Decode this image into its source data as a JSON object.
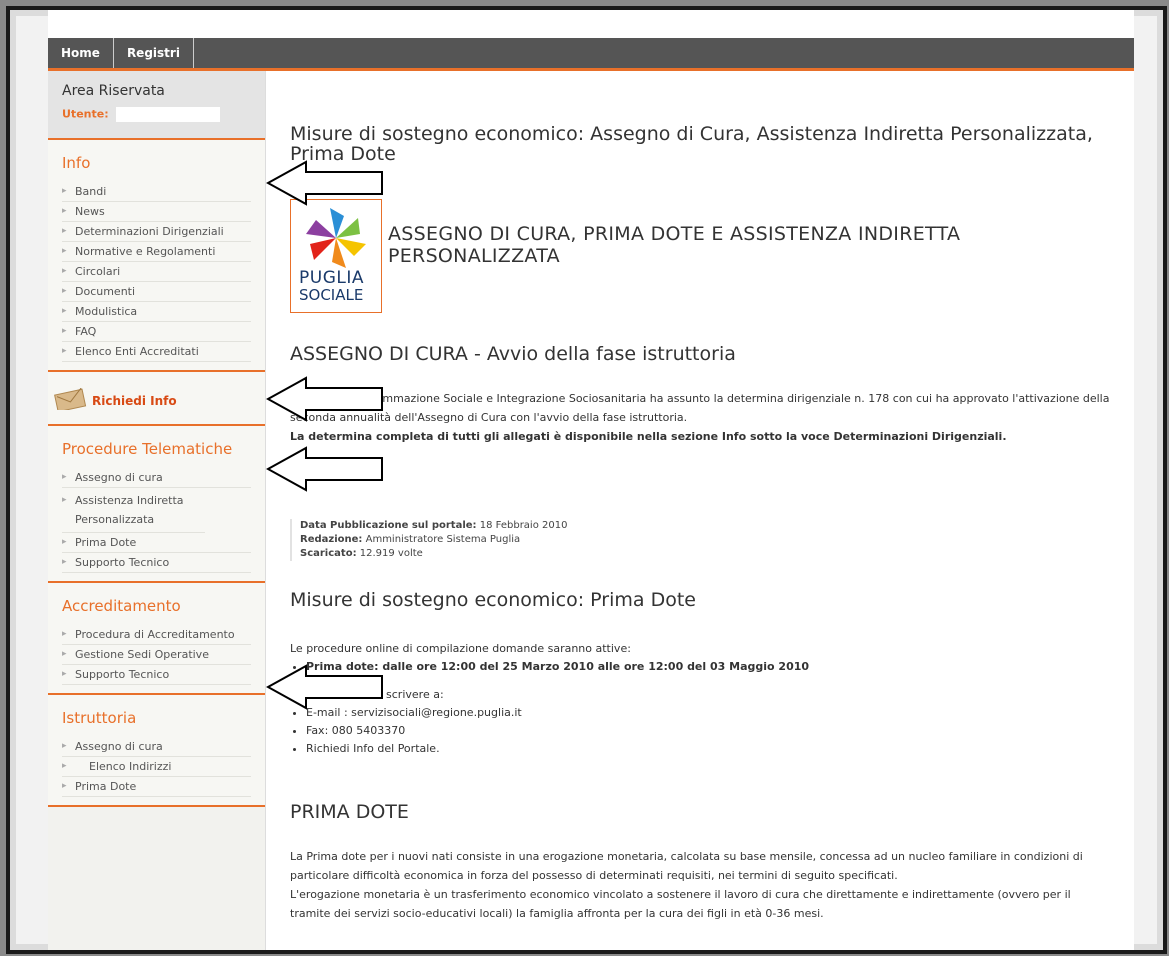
{
  "nav": {
    "home": "Home",
    "registri": "Registri"
  },
  "sidebar": {
    "area_title": "Area Riservata",
    "utente_label": "Utente:",
    "utente_value": "",
    "info": {
      "title": "Info",
      "items": [
        "Bandi",
        "News",
        "Determinazioni Dirigenziali",
        "Normative e Regolamenti",
        "Circolari",
        "Documenti",
        "Modulistica",
        "FAQ",
        "Elenco Enti Accreditati"
      ]
    },
    "richiedi_info": "Richiedi Info",
    "procedure": {
      "title": "Procedure Telematiche",
      "items": [
        "Assegno di cura",
        "Assistenza Indiretta Personalizzata",
        "Prima Dote",
        "Supporto Tecnico"
      ]
    },
    "accreditamento": {
      "title": "Accreditamento",
      "items": [
        "Procedura di Accreditamento",
        "Gestione Sedi Operative",
        "Supporto Tecnico"
      ]
    },
    "istruttoria": {
      "title": "Istruttoria",
      "items": [
        "Assegno di cura",
        "Elenco Indirizzi",
        "Prima Dote"
      ]
    }
  },
  "main": {
    "page_title": "Misure di sostegno economico: Assegno di Cura, Assistenza Indiretta Personalizzata, Prima Dote",
    "logo_text_1": "PUGLIA",
    "logo_text_2": "SOCIALE",
    "logo_heading": "ASSEGNO DI CURA, PRIMA DOTE E ASSISTENZA INDIRETTA PERSONALIZZATA",
    "section1_title": "ASSEGNO DI CURA - Avvio della fase istruttoria",
    "section1_p1": "Il Servizio Programmazione Sociale e Integrazione Sociosanitaria ha assunto la determina dirigenziale n. 178 con cui ha approvato l'attivazione della seconda annualità dell'Assegno di Cura con l'avvio della fase istruttoria.",
    "section1_p2": "La determina completa di tutti gli allegati è disponibile nella sezione Info sotto la voce Determinazioni Dirigenziali.",
    "meta": {
      "data_label": "Data Pubblicazione sul portale:",
      "data_value": "18 Febbraio 2010",
      "redazione_label": "Redazione:",
      "redazione_value": "Amministratore Sistema Puglia",
      "scaricato_label": "Scaricato:",
      "scaricato_value": "12.919 volte"
    },
    "section2_title": "Misure di sostegno economico: Prima Dote",
    "section2_intro": "Le procedure online di compilazione domande saranno attive:",
    "section2_bullet": "Prima dote: dalle ore 12:00 del 25 Marzo 2010 alle ore 12:00 del 03 Maggio 2010",
    "section2_info": "Per informazioni, scrivere a:",
    "contacts": [
      "E-mail : servizisociali@regione.puglia.it",
      "Fax: 080 5403370",
      "Richiedi Info del Portale."
    ],
    "section3_title": "PRIMA DOTE",
    "section3_p1": "La Prima dote per i nuovi nati consiste in una erogazione monetaria, calcolata su base mensile, concessa ad un nucleo familiare in condizioni di particolare difficoltà economica in forza del possesso di determinati requisiti, nei termini di seguito specificati.",
    "section3_p2": "L'erogazione monetaria è un trasferimento economico vincolato a sostenere il lavoro di cura che direttamente e indirettamente (ovvero per il tramite dei servizi socio-educativi locali) la famiglia affronta per la cura dei figli in età 0-36 mesi."
  },
  "colors": {
    "accent": "#e8702a",
    "nav_bg": "#555555"
  }
}
